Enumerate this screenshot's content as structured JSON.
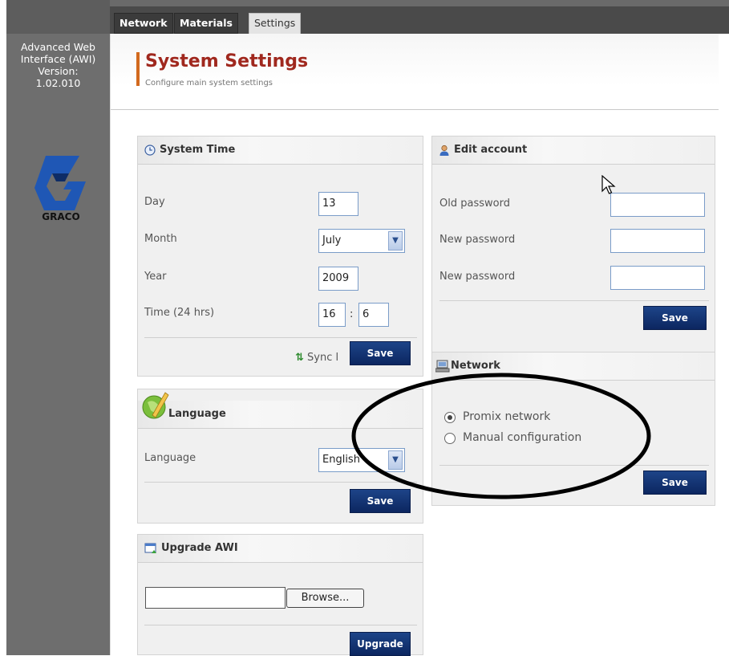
{
  "sidebar": {
    "app_name_line1": "Advanced Web",
    "app_name_line2": "Interface (AWI)",
    "version_label": "Version:",
    "version": "1.02.010",
    "logo_text": "GRACO"
  },
  "tabs": [
    {
      "label": "Network",
      "active": false
    },
    {
      "label": "Materials",
      "active": false
    },
    {
      "label": "Settings",
      "active": true
    }
  ],
  "header": {
    "title": "System Settings",
    "subtitle": "Configure main system settings"
  },
  "system_time": {
    "title": "System Time",
    "day_label": "Day",
    "day_value": "13",
    "month_label": "Month",
    "month_value": "July",
    "year_label": "Year",
    "year_value": "2009",
    "time_label": "Time (24 hrs)",
    "hour_value": "16",
    "time_separator": ":",
    "minute_value": "6",
    "sync_label": "Sync l",
    "save_label": "Save"
  },
  "language": {
    "title": "Language",
    "language_label": "Language",
    "language_value": "English",
    "save_label": "Save"
  },
  "upgrade": {
    "title": "Upgrade AWI",
    "file_value": "",
    "browse_label": "Browse...",
    "upgrade_label": "Upgrade"
  },
  "edit_account": {
    "title": "Edit account",
    "old_password_label": "Old password",
    "new_password_label": "New password",
    "confirm_password_label": "New password",
    "save_label": "Save"
  },
  "network": {
    "title": "Network",
    "options": [
      {
        "label": "Promix network",
        "selected": true
      },
      {
        "label": "Manual configuration",
        "selected": false
      }
    ],
    "save_label": "Save"
  },
  "colors": {
    "title_red": "#a0281e",
    "accent_orange": "#d2691e",
    "button_navy": "#0c2660",
    "sidebar_gray": "#6e6e6e",
    "graco_blue": "#1f57b5"
  },
  "icons": [
    "clock-icon",
    "user-icon",
    "network-computer-icon",
    "globe-pencil-icon",
    "upgrade-window-icon",
    "sync-arrows-icon",
    "chevron-down-icon",
    "mouse-cursor-icon"
  ]
}
